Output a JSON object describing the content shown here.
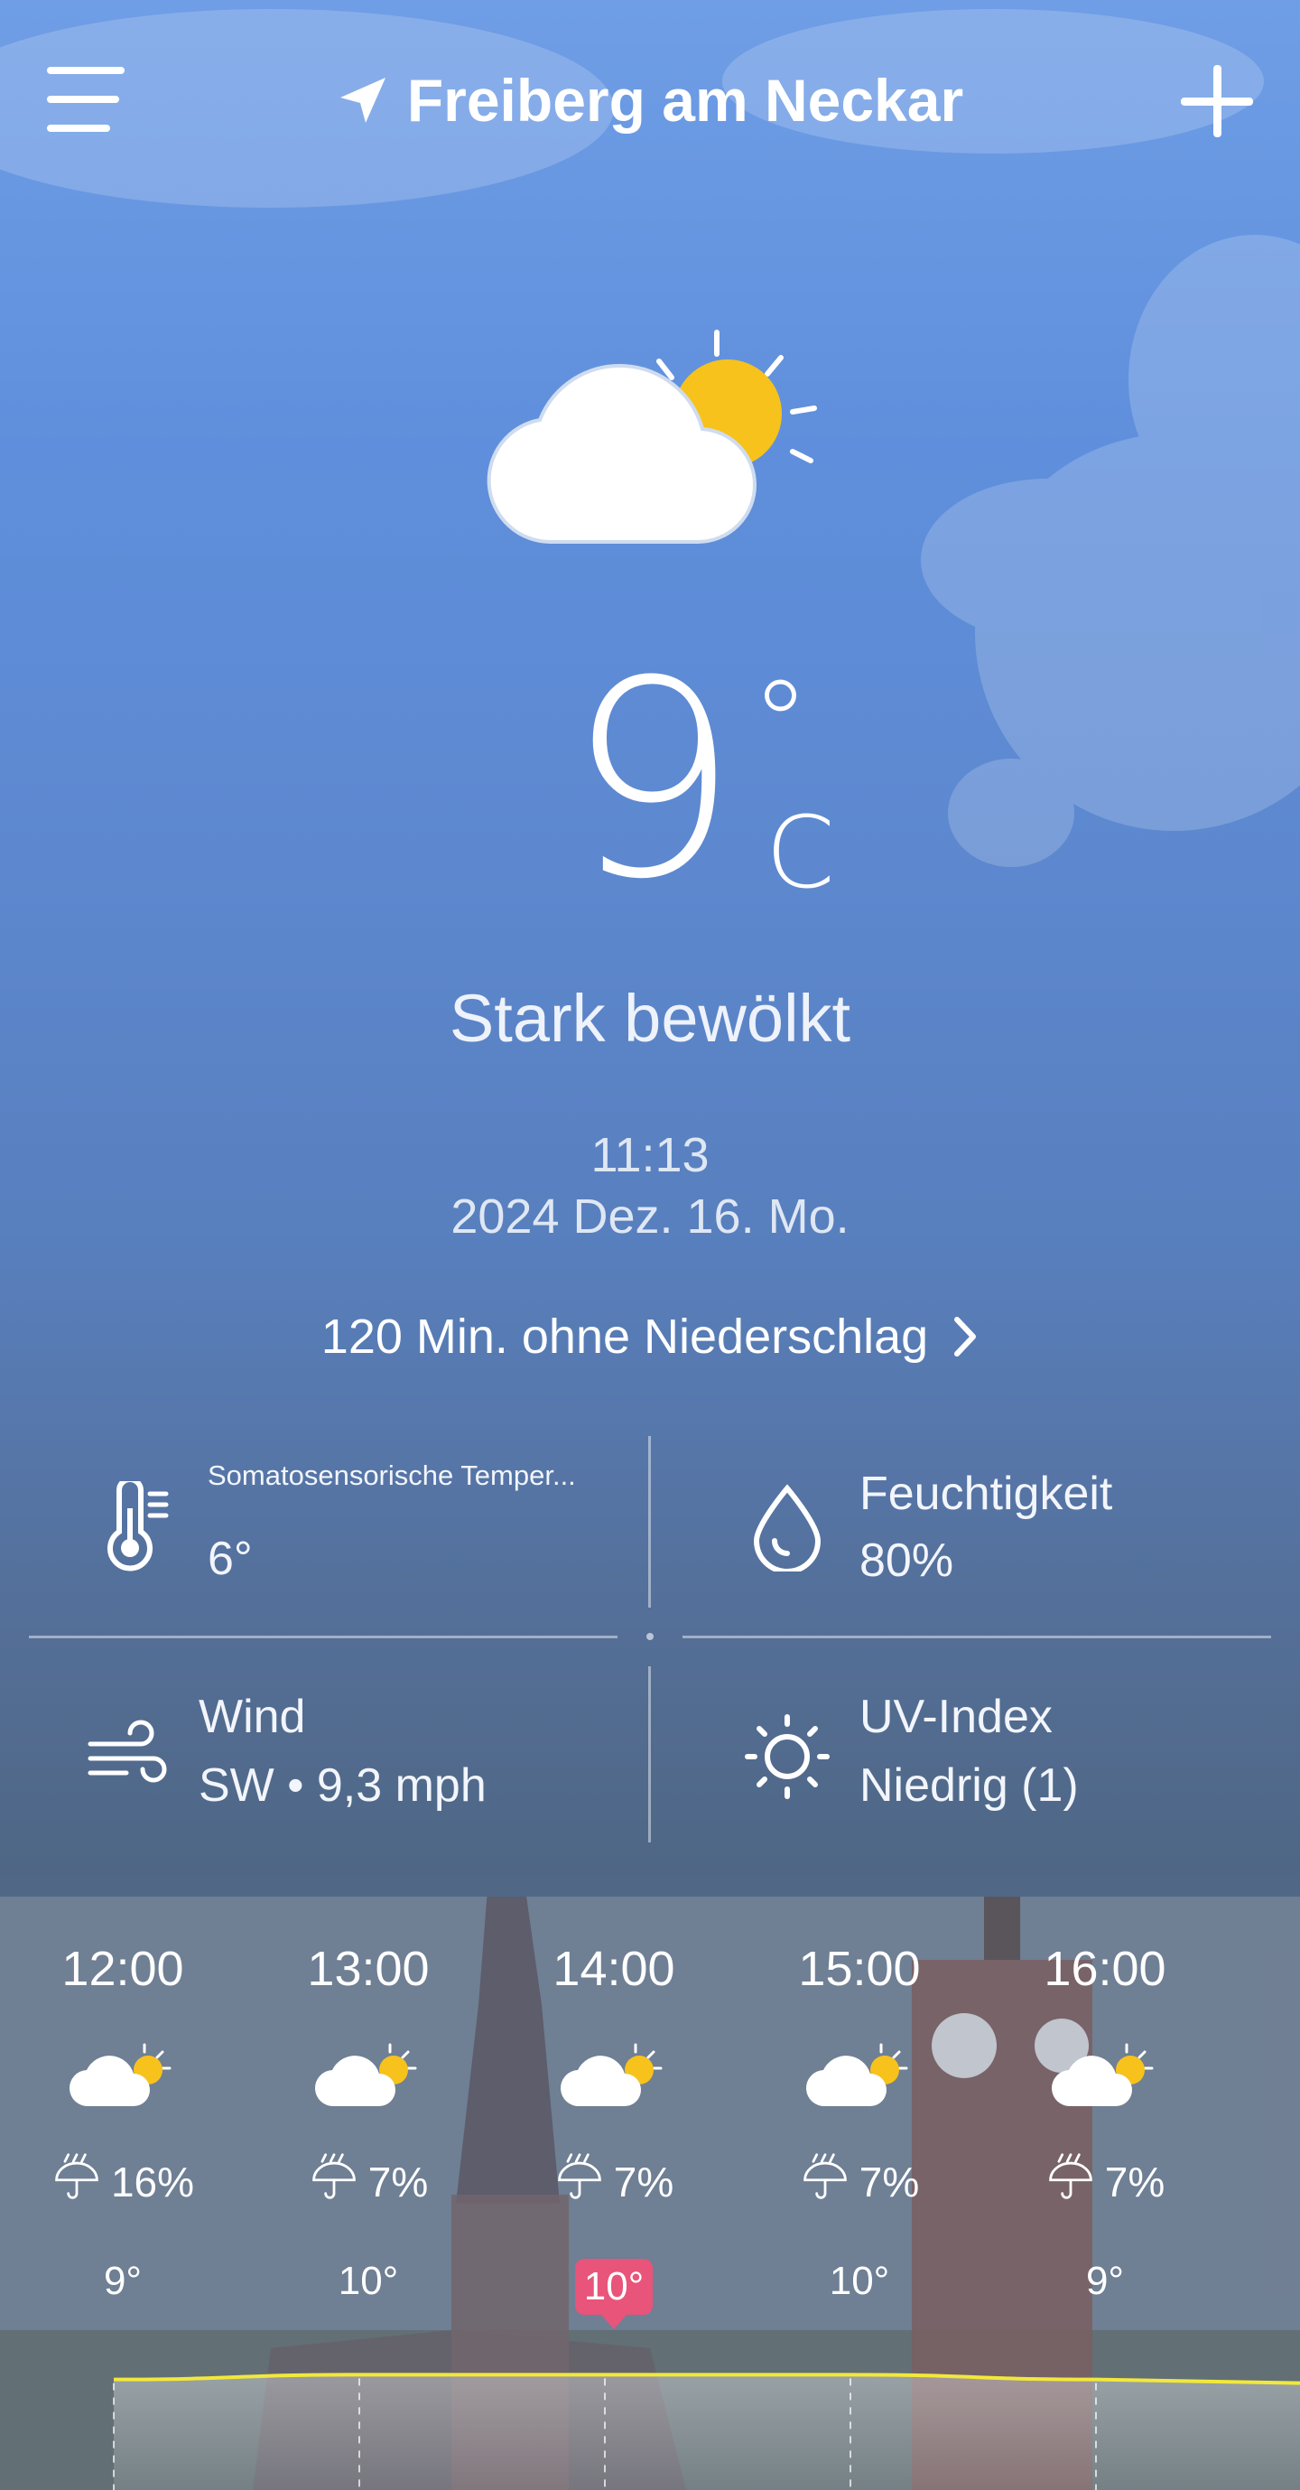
{
  "header": {
    "location": "Freiberg am Neckar"
  },
  "current": {
    "temperature": "9",
    "degree": "°",
    "unit": "C",
    "condition": "Stark bewölkt",
    "time": "11:13",
    "date": "2024 Dez. 16. Mo.",
    "precip_forecast": "120 Min. ohne Niederschlag"
  },
  "details": {
    "feels_like": {
      "label": "Somatosensorische Temper...",
      "value": "6°"
    },
    "humidity": {
      "label": "Feuchtigkeit",
      "value": "80%"
    },
    "wind": {
      "label": "Wind",
      "value": "SW • 9,3 mph"
    },
    "uv": {
      "label": "UV-Index",
      "value": "Niedrig (1)"
    }
  },
  "hourly": [
    {
      "time": "12:00",
      "rain": "16%",
      "temp": "9°",
      "highlight": false
    },
    {
      "time": "13:00",
      "rain": "7%",
      "temp": "10°",
      "highlight": false
    },
    {
      "time": "14:00",
      "rain": "7%",
      "temp": "10°",
      "highlight": true
    },
    {
      "time": "15:00",
      "rain": "7%",
      "temp": "10°",
      "highlight": false
    },
    {
      "time": "16:00",
      "rain": "7%",
      "temp": "9°",
      "highlight": false
    }
  ],
  "colors": {
    "highlight": "#e8547a",
    "temp_line": "#f2e83a",
    "sun": "#f7c21b"
  },
  "icons": [
    "menu-icon",
    "location-arrow-icon",
    "add-icon",
    "partly-cloudy-icon",
    "chevron-right-icon",
    "thermometer-icon",
    "droplet-icon",
    "wind-icon",
    "uv-sun-icon",
    "umbrella-rain-icon"
  ]
}
